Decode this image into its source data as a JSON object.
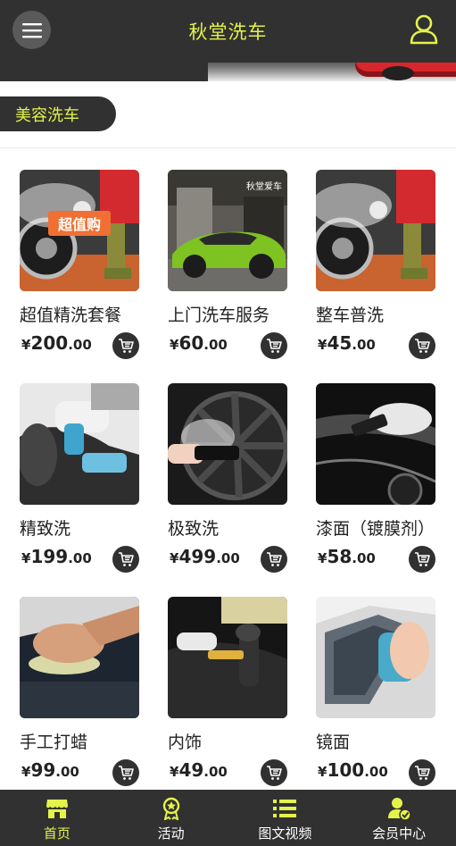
{
  "header": {
    "title": "秋堂洗车"
  },
  "section": {
    "title": "美容洗车"
  },
  "products": [
    {
      "name": "超值精洗套餐",
      "currency": "¥",
      "price_int": "200",
      "price_dec": ".00",
      "badge": "超值购"
    },
    {
      "name": "上门洗车服务",
      "currency": "¥",
      "price_int": "60",
      "price_dec": ".00",
      "sign": "秋堂爱车"
    },
    {
      "name": "整车普洗",
      "currency": "¥",
      "price_int": "45",
      "price_dec": ".00"
    },
    {
      "name": "精致洗",
      "currency": "¥",
      "price_int": "199",
      "price_dec": ".00"
    },
    {
      "name": "极致洗",
      "currency": "¥",
      "price_int": "499",
      "price_dec": ".00"
    },
    {
      "name": "漆面（镀膜剂）",
      "currency": "¥",
      "price_int": "58",
      "price_dec": ".00"
    },
    {
      "name": "手工打蜡",
      "currency": "¥",
      "price_int": "99",
      "price_dec": ".00"
    },
    {
      "name": "内饰",
      "currency": "¥",
      "price_int": "49",
      "price_dec": ".00"
    },
    {
      "name": "镜面",
      "currency": "¥",
      "price_int": "100",
      "price_dec": ".00"
    }
  ],
  "tabbar": {
    "items": [
      {
        "label": "首页",
        "icon": "store-icon",
        "active": true
      },
      {
        "label": "活动",
        "icon": "award-icon",
        "active": false
      },
      {
        "label": "图文视频",
        "icon": "list-icon",
        "active": false
      },
      {
        "label": "会员中心",
        "icon": "member-icon",
        "active": false
      }
    ]
  },
  "colors": {
    "accent": "#e4f34a",
    "dark": "#313131"
  }
}
